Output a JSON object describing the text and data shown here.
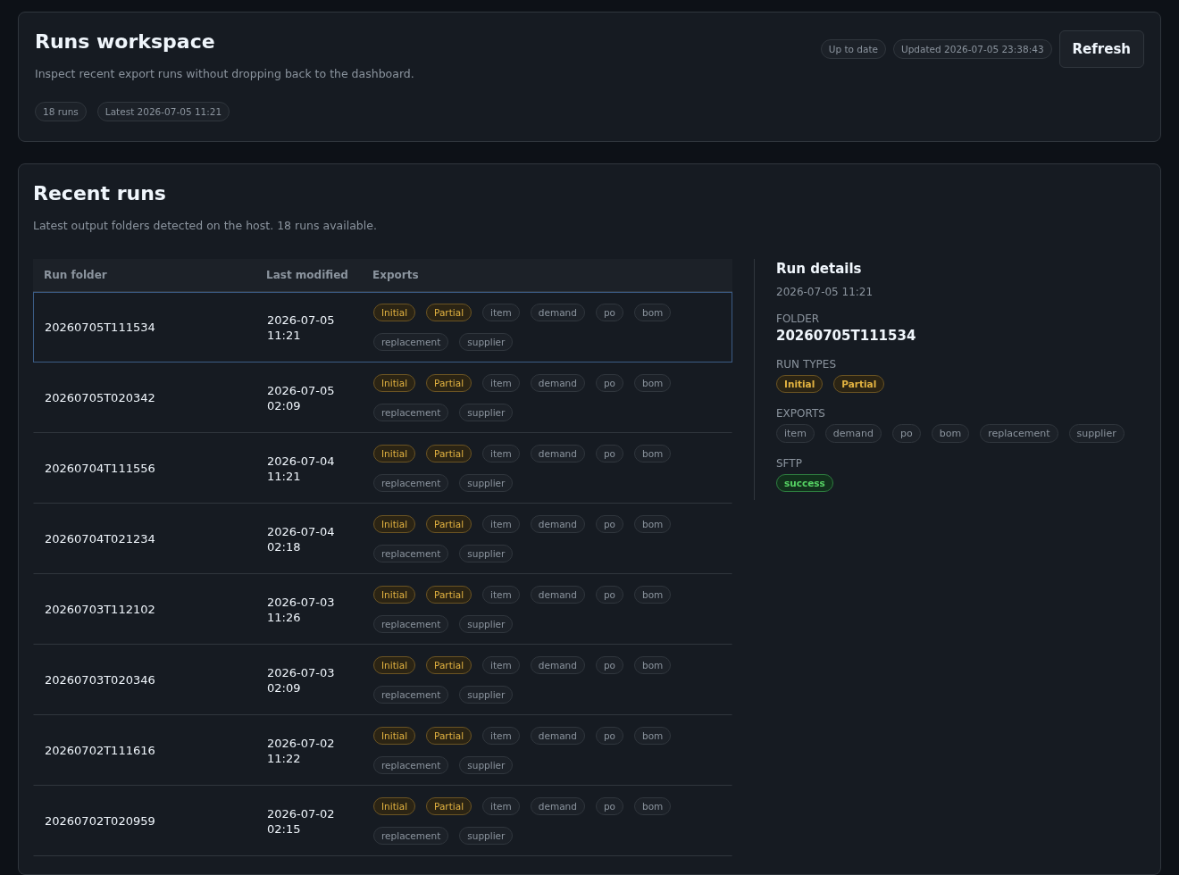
{
  "header": {
    "title": "Runs workspace",
    "subtitle": "Inspect recent export runs without dropping back to the dashboard.",
    "chips": [
      "18 runs",
      "Latest 2026-07-05 11:21"
    ],
    "status": "Up to date",
    "updated": "Updated 2026-07-05 23:38:43",
    "refresh": "Refresh"
  },
  "runs_card": {
    "title": "Recent runs",
    "subtitle": "Latest output folders detected on the host. 18 runs available.",
    "columns": [
      "Run folder",
      "Last modified",
      "Exports"
    ],
    "rows": [
      {
        "folder": "20260705T111534",
        "date": "2026-07-05",
        "time": "11:21",
        "selected": true,
        "tags": [
          {
            "label": "Initial",
            "kind": "run_type"
          },
          {
            "label": "Partial",
            "kind": "run_type"
          },
          {
            "label": "item",
            "kind": "export"
          },
          {
            "label": "demand",
            "kind": "export"
          },
          {
            "label": "po",
            "kind": "export"
          },
          {
            "label": "bom",
            "kind": "export"
          },
          {
            "label": "replacement",
            "kind": "export"
          },
          {
            "label": "supplier",
            "kind": "export"
          }
        ]
      },
      {
        "folder": "20260705T020342",
        "date": "2026-07-05",
        "time": "02:09",
        "selected": false,
        "tags": [
          {
            "label": "Initial",
            "kind": "run_type"
          },
          {
            "label": "Partial",
            "kind": "run_type"
          },
          {
            "label": "item",
            "kind": "export"
          },
          {
            "label": "demand",
            "kind": "export"
          },
          {
            "label": "po",
            "kind": "export"
          },
          {
            "label": "bom",
            "kind": "export"
          },
          {
            "label": "replacement",
            "kind": "export"
          },
          {
            "label": "supplier",
            "kind": "export"
          }
        ]
      },
      {
        "folder": "20260704T111556",
        "date": "2026-07-04",
        "time": "11:21",
        "selected": false,
        "tags": [
          {
            "label": "Initial",
            "kind": "run_type"
          },
          {
            "label": "Partial",
            "kind": "run_type"
          },
          {
            "label": "item",
            "kind": "export"
          },
          {
            "label": "demand",
            "kind": "export"
          },
          {
            "label": "po",
            "kind": "export"
          },
          {
            "label": "bom",
            "kind": "export"
          },
          {
            "label": "replacement",
            "kind": "export"
          },
          {
            "label": "supplier",
            "kind": "export"
          }
        ]
      },
      {
        "folder": "20260704T021234",
        "date": "2026-07-04",
        "time": "02:18",
        "selected": false,
        "tags": [
          {
            "label": "Initial",
            "kind": "run_type"
          },
          {
            "label": "Partial",
            "kind": "run_type"
          },
          {
            "label": "item",
            "kind": "export"
          },
          {
            "label": "demand",
            "kind": "export"
          },
          {
            "label": "po",
            "kind": "export"
          },
          {
            "label": "bom",
            "kind": "export"
          },
          {
            "label": "replacement",
            "kind": "export"
          },
          {
            "label": "supplier",
            "kind": "export"
          }
        ]
      },
      {
        "folder": "20260703T112102",
        "date": "2026-07-03",
        "time": "11:26",
        "selected": false,
        "tags": [
          {
            "label": "Initial",
            "kind": "run_type"
          },
          {
            "label": "Partial",
            "kind": "run_type"
          },
          {
            "label": "item",
            "kind": "export"
          },
          {
            "label": "demand",
            "kind": "export"
          },
          {
            "label": "po",
            "kind": "export"
          },
          {
            "label": "bom",
            "kind": "export"
          },
          {
            "label": "replacement",
            "kind": "export"
          },
          {
            "label": "supplier",
            "kind": "export"
          }
        ]
      },
      {
        "folder": "20260703T020346",
        "date": "2026-07-03",
        "time": "02:09",
        "selected": false,
        "tags": [
          {
            "label": "Initial",
            "kind": "run_type"
          },
          {
            "label": "Partial",
            "kind": "run_type"
          },
          {
            "label": "item",
            "kind": "export"
          },
          {
            "label": "demand",
            "kind": "export"
          },
          {
            "label": "po",
            "kind": "export"
          },
          {
            "label": "bom",
            "kind": "export"
          },
          {
            "label": "replacement",
            "kind": "export"
          },
          {
            "label": "supplier",
            "kind": "export"
          }
        ]
      },
      {
        "folder": "20260702T111616",
        "date": "2026-07-02",
        "time": "11:22",
        "selected": false,
        "tags": [
          {
            "label": "Initial",
            "kind": "run_type"
          },
          {
            "label": "Partial",
            "kind": "run_type"
          },
          {
            "label": "item",
            "kind": "export"
          },
          {
            "label": "demand",
            "kind": "export"
          },
          {
            "label": "po",
            "kind": "export"
          },
          {
            "label": "bom",
            "kind": "export"
          },
          {
            "label": "replacement",
            "kind": "export"
          },
          {
            "label": "supplier",
            "kind": "export"
          }
        ]
      },
      {
        "folder": "20260702T020959",
        "date": "2026-07-02",
        "time": "02:15",
        "selected": false,
        "tags": [
          {
            "label": "Initial",
            "kind": "run_type"
          },
          {
            "label": "Partial",
            "kind": "run_type"
          },
          {
            "label": "item",
            "kind": "export"
          },
          {
            "label": "demand",
            "kind": "export"
          },
          {
            "label": "po",
            "kind": "export"
          },
          {
            "label": "bom",
            "kind": "export"
          },
          {
            "label": "replacement",
            "kind": "export"
          },
          {
            "label": "supplier",
            "kind": "export"
          }
        ]
      }
    ]
  },
  "details": {
    "title": "Run details",
    "timestamp": "2026-07-05 11:21",
    "folder_label": "FOLDER",
    "folder": "20260705T111534",
    "run_types_label": "RUN TYPES",
    "run_types": [
      "Initial",
      "Partial"
    ],
    "exports_label": "EXPORTS",
    "exports": [
      "item",
      "demand",
      "po",
      "bom",
      "replacement",
      "supplier"
    ],
    "sftp_label": "SFTP",
    "sftp": {
      "label": "success",
      "kind": "success"
    }
  }
}
